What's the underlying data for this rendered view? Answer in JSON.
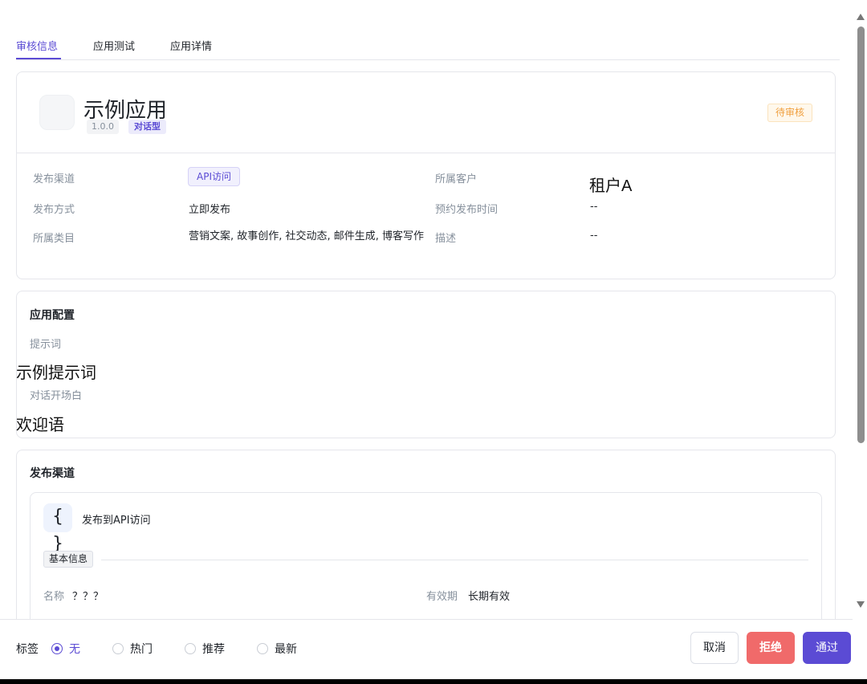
{
  "tabs": [
    {
      "label": "审核信息",
      "active": true
    },
    {
      "label": "应用测试",
      "active": false
    },
    {
      "label": "应用详情",
      "active": false
    }
  ],
  "app": {
    "name": "示例应用",
    "version": "1.0.0",
    "type": "对话型",
    "status": "待审核"
  },
  "info": {
    "channel_label": "发布渠道",
    "channel_value": "API访问",
    "customer_label": "所属客户",
    "customer_value": "租户A",
    "method_label": "发布方式",
    "method_value": "立即发布",
    "schedule_label": "预约发布时间",
    "schedule_value": "--",
    "category_label": "所属类目",
    "category_value": "营销文案, 故事创作, 社交动态, 邮件生成, 博客写作",
    "desc_label": "描述",
    "desc_value": "--"
  },
  "config": {
    "title": "应用配置",
    "prompt_label": "提示词",
    "prompt_value": "示例提示词",
    "opening_label": "对话开场白",
    "opening_value": "欢迎语"
  },
  "channel": {
    "title": "发布渠道",
    "api_icon_glyph": "{ }",
    "api_title": "发布到API访问",
    "basic_info_tag": "基本信息",
    "name_label": "名称",
    "name_value": "？？？",
    "validity_label": "有效期",
    "validity_value": "长期有效"
  },
  "footer": {
    "tags_label": "标签",
    "tag_options": [
      {
        "label": "无",
        "checked": true
      },
      {
        "label": "热门",
        "checked": false
      },
      {
        "label": "推荐",
        "checked": false
      },
      {
        "label": "最新",
        "checked": false
      }
    ],
    "cancel_label": "取消",
    "reject_label": "拒绝",
    "approve_label": "通过"
  },
  "colors": {
    "accent": "#5b4bd4",
    "reject": "#f06a6a",
    "pending": "#f0a040"
  }
}
